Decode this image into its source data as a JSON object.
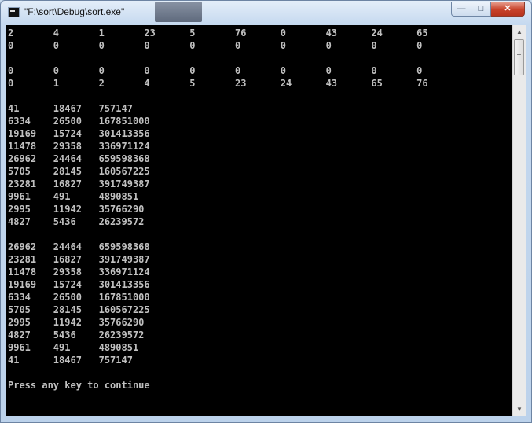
{
  "window": {
    "title": "\"F:\\sort\\Debug\\sort.exe\""
  },
  "caption_buttons": {
    "minimize": "—",
    "maximize": "□",
    "close": "✕"
  },
  "scrollbar": {
    "up": "▲",
    "down": "▼"
  },
  "console": {
    "lines": [
      "2       4       1       23      5       76      0       43      24      65",
      "0       0       0       0       0       0       0       0       0       0",
      "",
      "0       0       0       0       0       0       0       0       0       0",
      "0       1       2       4       5       23      24      43      65      76",
      "",
      "41      18467   757147",
      "6334    26500   167851000",
      "19169   15724   301413356",
      "11478   29358   336971124",
      "26962   24464   659598368",
      "5705    28145   160567225",
      "23281   16827   391749387",
      "9961    491     4890851",
      "2995    11942   35766290",
      "4827    5436    26239572",
      "",
      "26962   24464   659598368",
      "23281   16827   391749387",
      "11478   29358   336971124",
      "19169   15724   301413356",
      "6334    26500   167851000",
      "5705    28145   160567225",
      "2995    11942   35766290",
      "4827    5436    26239572",
      "9961    491     4890851",
      "41      18467   757147",
      "",
      "Press any key to continue"
    ]
  }
}
